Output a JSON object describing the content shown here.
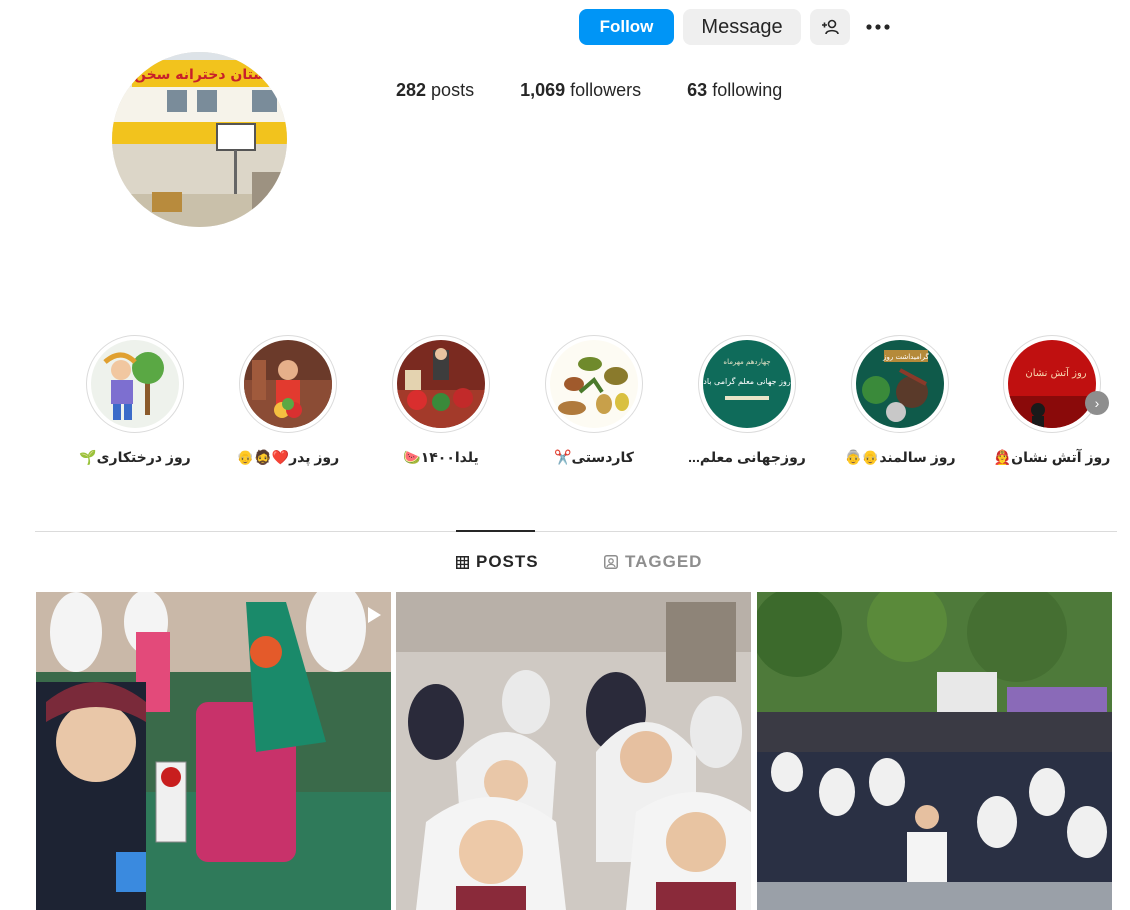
{
  "header": {
    "follow_label": "Follow",
    "message_label": "Message"
  },
  "stats": {
    "posts_count": "282",
    "posts_label": " posts",
    "followers_count": "1,069",
    "followers_label": " followers",
    "following_count": "63",
    "following_label": " following"
  },
  "avatar": {
    "sign_text": "دبستان دخترانه سخن"
  },
  "highlights": [
    {
      "label": "روز درختکاری🌱"
    },
    {
      "label": "روز پدر❤️🧔👴"
    },
    {
      "label": "یلدا۱۴۰۰🍉"
    },
    {
      "label": "کاردستی✂️"
    },
    {
      "label": "روزجهانی معلم..."
    },
    {
      "label": "روز سالمند👴👵"
    },
    {
      "label": "روز آتش نشان👨‍🚒"
    }
  ],
  "highlight_texts": {
    "teacher_day_line1": "چهاردهم مهرماه",
    "teacher_day_line2": "روز جهانی معلم گرامی باد",
    "elderly_day": "گرامیداشت روز",
    "firefighter_day": "روز آتش نشان"
  },
  "tabs": {
    "posts": "POSTS",
    "tagged": "TAGGED"
  },
  "colors": {
    "follow_blue": "#0095f6",
    "button_gray": "#efefef",
    "divider": "#dbdbdb"
  }
}
